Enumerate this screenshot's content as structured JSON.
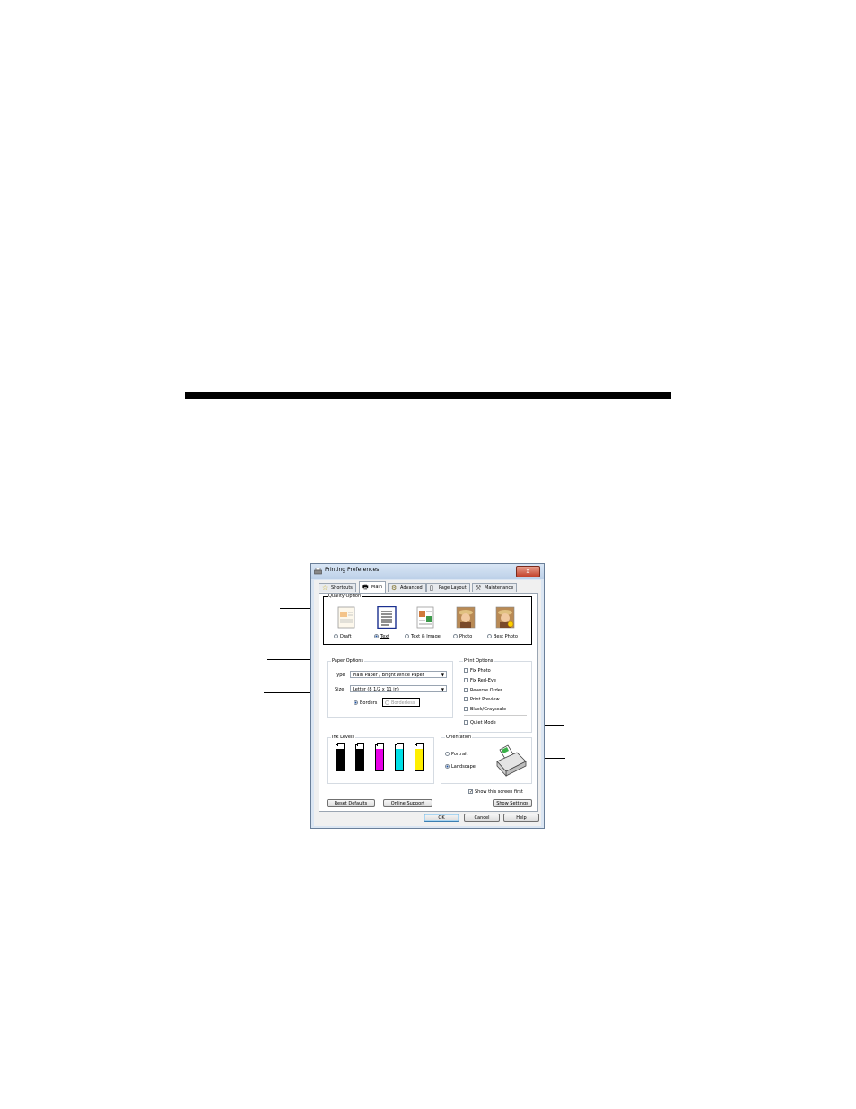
{
  "dialog": {
    "title": "Printing Preferences",
    "close_label": "x",
    "tabs": [
      {
        "label": "Shortcuts",
        "icon": "star-icon"
      },
      {
        "label": "Main",
        "icon": "printer-icon"
      },
      {
        "label": "Advanced",
        "icon": "gears-icon"
      },
      {
        "label": "Page Layout",
        "icon": "page-icon"
      },
      {
        "label": "Maintenance",
        "icon": "wrench-icon"
      }
    ],
    "quality": {
      "label": "Quality Option",
      "options": [
        "Draft",
        "Text",
        "Text & Image",
        "Photo",
        "Best Photo"
      ],
      "selected": "Text"
    },
    "paper": {
      "label": "Paper Options",
      "type_label": "Type",
      "type_value": "Plain Paper / Bright White Paper",
      "size_label": "Size",
      "size_value": "Letter (8 1/2 x 11 in)",
      "borders_label": "Borders",
      "borderless_label": "Borderless",
      "selected": "Borders"
    },
    "print_options": {
      "label": "Print Options",
      "items": [
        "Fix Photo",
        "Fix Red-Eye",
        "Reverse Order",
        "Print Preview",
        "Black/Grayscale"
      ],
      "quiet_mode": "Quiet Mode"
    },
    "ink": {
      "label": "Ink Levels",
      "colors": [
        "#000000",
        "#000000",
        "#e800e8",
        "#00e0e8",
        "#ffef00"
      ],
      "levels": [
        0.85,
        0.85,
        0.85,
        0.85,
        0.85
      ]
    },
    "orientation": {
      "label": "Orientation",
      "portrait": "Portrait",
      "landscape": "Landscape",
      "selected": "Landscape"
    },
    "show_screen_first": "Show this screen first",
    "buttons": {
      "reset": "Reset Defaults",
      "online": "Online Support",
      "show_settings": "Show Settings",
      "ok": "OK",
      "cancel": "Cancel",
      "help": "Help"
    }
  }
}
